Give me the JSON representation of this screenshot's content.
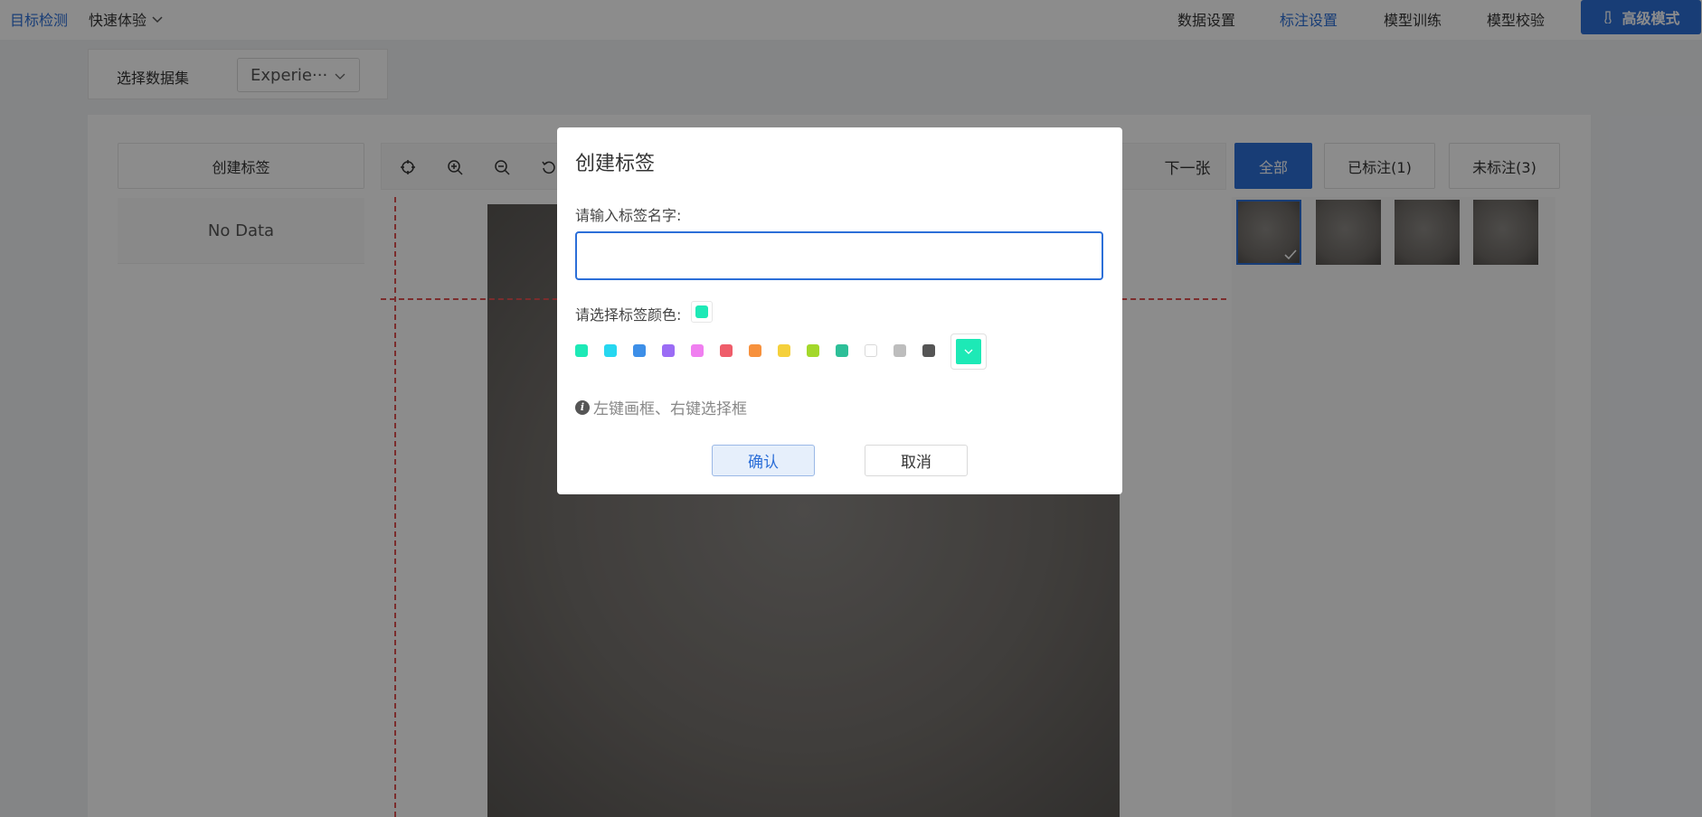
{
  "topbar": {
    "brand": "目标检测",
    "quick_menu": "快速体验",
    "nav": [
      "数据设置",
      "标注设置",
      "模型训练",
      "模型校验"
    ],
    "active_nav": "标注设置",
    "advanced_button": "高级模式"
  },
  "dataset": {
    "label": "选择数据集",
    "selected": "Experie···"
  },
  "left_panel": {
    "create_label": "创建标签",
    "empty_text": "No Data"
  },
  "toolbar": {
    "tools": [
      "crosshair-icon",
      "zoom-in-icon",
      "zoom-out-icon",
      "rotate-icon"
    ],
    "next_button": "下一张"
  },
  "filters": {
    "all": "全部",
    "labeled": "已标注(1)",
    "unlabeled": "未标注(3)"
  },
  "thumbnails": [
    {
      "selected": true,
      "labeled": true
    },
    {
      "selected": false,
      "labeled": false
    },
    {
      "selected": false,
      "labeled": false
    },
    {
      "selected": false,
      "labeled": false
    }
  ],
  "modal": {
    "title": "创建标签",
    "name_label": "请输入标签名字:",
    "name_value": "",
    "color_label": "请选择标签颜色:",
    "current_color": "#1de9b6",
    "palette": [
      "#1de9b6",
      "#26d7f0",
      "#3d8fe8",
      "#9b6cf5",
      "#f07ff0",
      "#ef5d6a",
      "#f7913d",
      "#f5d03b",
      "#a3d82a",
      "#2dbf98",
      "#ffffff",
      "#bdbdbd",
      "#555555"
    ],
    "hint": "左键画框、右键选择框",
    "confirm": "确认",
    "cancel": "取消"
  },
  "colors": {
    "primary": "#2c6fd8",
    "guide": "#e05353"
  }
}
